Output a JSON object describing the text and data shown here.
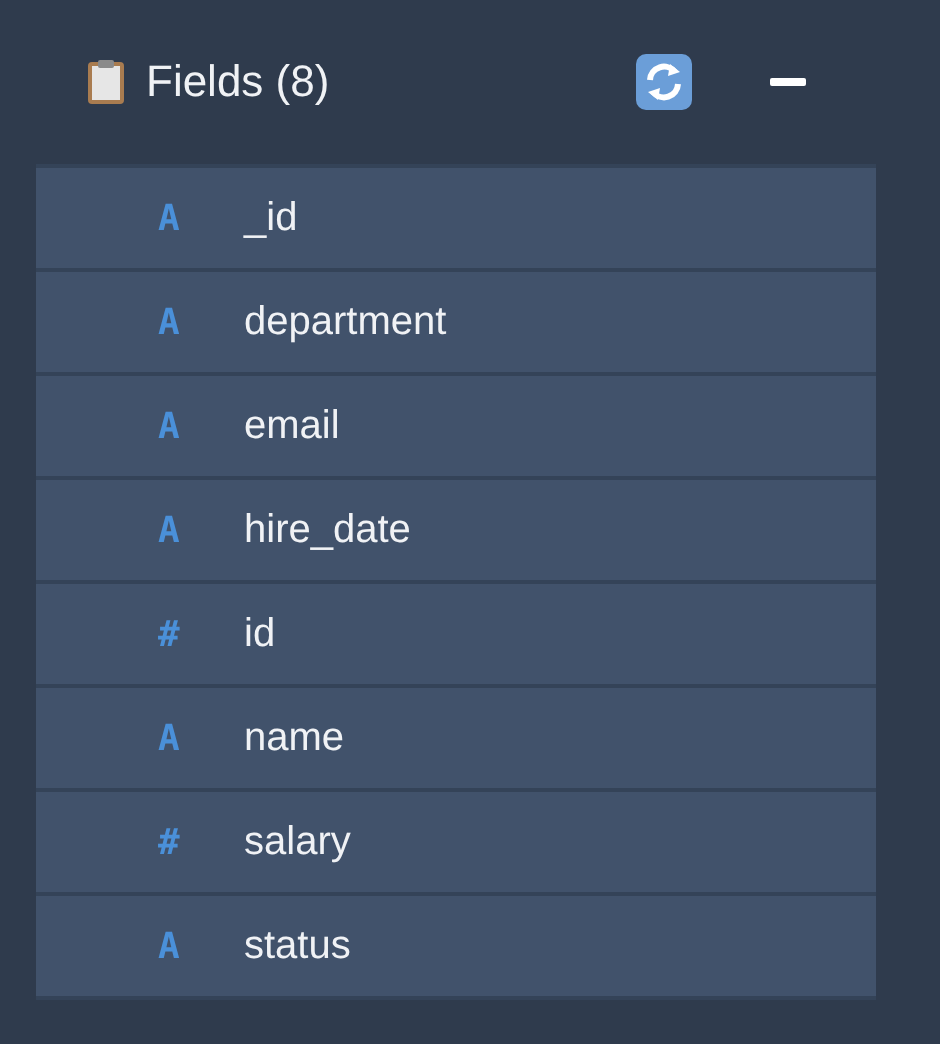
{
  "header": {
    "title": "Fields (8)"
  },
  "fields": [
    {
      "type_glyph": "A",
      "name": "_id"
    },
    {
      "type_glyph": "A",
      "name": "department"
    },
    {
      "type_glyph": "A",
      "name": "email"
    },
    {
      "type_glyph": "A",
      "name": "hire_date"
    },
    {
      "type_glyph": "#",
      "name": "id"
    },
    {
      "type_glyph": "A",
      "name": "name"
    },
    {
      "type_glyph": "#",
      "name": "salary"
    },
    {
      "type_glyph": "A",
      "name": "status"
    }
  ]
}
